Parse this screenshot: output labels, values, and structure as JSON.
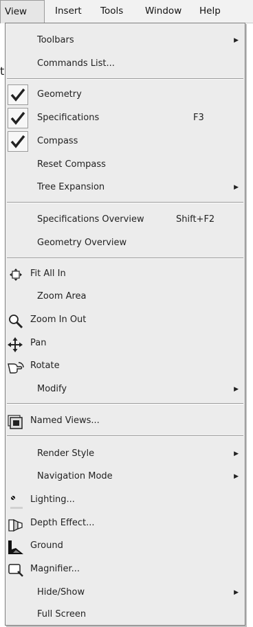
{
  "menubar": {
    "items": [
      {
        "label": "View"
      },
      {
        "label": "Insert"
      },
      {
        "label": "Tools"
      },
      {
        "label": "Window"
      },
      {
        "label": "Help"
      }
    ]
  },
  "background_fragment": "t",
  "menu": {
    "items": [
      {
        "label": "Toolbars",
        "submenu": true
      },
      {
        "label": "Commands List..."
      },
      {
        "label": "Geometry",
        "checked": true
      },
      {
        "label": "Specifications",
        "checked": true,
        "shortcut": "F3"
      },
      {
        "label": "Compass",
        "checked": true
      },
      {
        "label": "Reset Compass"
      },
      {
        "label": "Tree Expansion",
        "submenu": true
      },
      {
        "label": "Specifications Overview",
        "shortcut": "Shift+F2"
      },
      {
        "label": "Geometry Overview"
      },
      {
        "label": "Fit All In",
        "icon": "fit-all-in-icon"
      },
      {
        "label": "Zoom Area"
      },
      {
        "label": "Zoom In Out",
        "icon": "magnifier-zoom-icon"
      },
      {
        "label": "Pan",
        "icon": "pan-arrows-icon"
      },
      {
        "label": "Rotate",
        "icon": "rotate-hand-icon"
      },
      {
        "label": "Modify",
        "submenu": true
      },
      {
        "label": "Named Views...",
        "icon": "named-views-icon"
      },
      {
        "label": "Render Style",
        "submenu": true
      },
      {
        "label": "Navigation Mode",
        "submenu": true
      },
      {
        "label": "Lighting...",
        "icon": "lighting-icon"
      },
      {
        "label": "Depth Effect...",
        "icon": "depth-effect-icon"
      },
      {
        "label": "Ground",
        "icon": "ground-icon"
      },
      {
        "label": "Magnifier...",
        "icon": "magnifier-window-icon"
      },
      {
        "label": "Hide/Show",
        "submenu": true
      },
      {
        "label": "Full Screen"
      }
    ]
  }
}
